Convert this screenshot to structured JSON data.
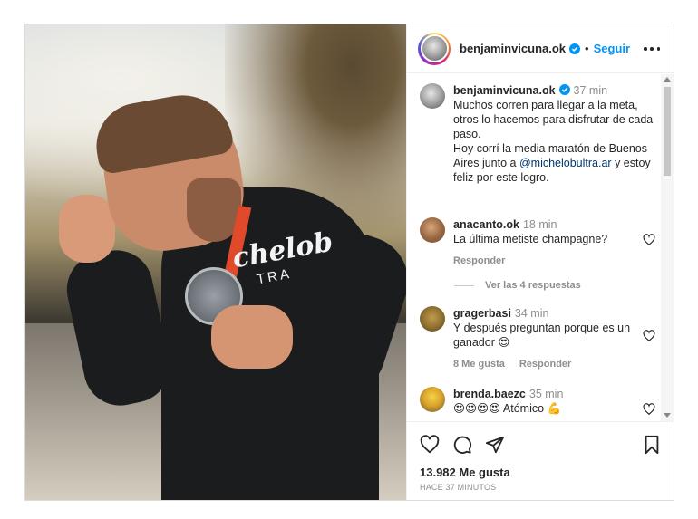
{
  "header": {
    "username": "benjaminvicuna.ok",
    "follow_label": "Seguir",
    "separator": "•"
  },
  "caption": {
    "username": "benjaminvicuna.ok",
    "time": "37 min",
    "text_1": "Muchos corren para llegar a la meta, otros lo hacemos para disfrutar de cada paso.",
    "text_2_before": "Hoy corrí la media maratón de Buenos Aires junto a ",
    "mention": "@michelobultra.ar",
    "text_2_after": " y estoy feliz por este logro."
  },
  "comments": [
    {
      "username": "anacanto.ok",
      "time": "18 min",
      "text": "La última metiste champagne?",
      "reply_label": "Responder"
    },
    {
      "username": "gragerbasi",
      "time": "34 min",
      "text": "Y después preguntan porque es un ganador 😍",
      "likes_label": "8 Me gusta",
      "reply_label": "Responder"
    },
    {
      "username": "brenda.baezc",
      "time": "35 min",
      "text": "😍😍😍😍 Atómico 💪"
    }
  ],
  "view_replies": "Ver las 4 respuestas",
  "photo": {
    "brand_line_1": "chelob",
    "brand_line_2": "TRA"
  },
  "footer": {
    "likes": "13.982 Me gusta",
    "posted": "HACE 37 MINUTOS"
  },
  "icons": [
    "more-icon",
    "verified-icon",
    "heart-icon",
    "comment-icon",
    "share-icon",
    "save-icon"
  ],
  "colors": {
    "accent": "#0095f6",
    "verified": "#0095f6",
    "text": "#262626",
    "muted": "#8e8e8e",
    "mention": "#00376b"
  }
}
